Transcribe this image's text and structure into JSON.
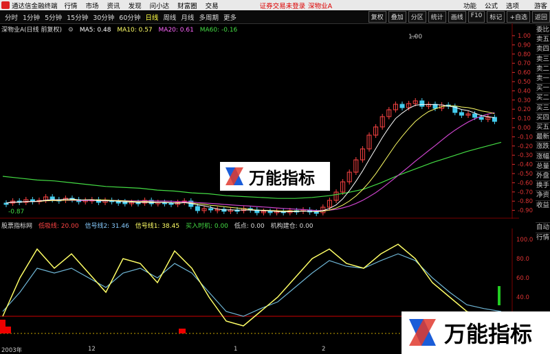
{
  "menubar": {
    "app_title": "通达信金融终端",
    "items": [
      "行情",
      "市场",
      "资讯",
      "发现",
      "问小达",
      "财富圈",
      "交易"
    ],
    "warning": "证券交易未登录",
    "stock_link": "深物业A",
    "right_items": [
      "功能",
      "公式",
      "选项",
      "游客"
    ]
  },
  "periodbar": {
    "periods": [
      "分时",
      "1分钟",
      "5分钟",
      "15分钟",
      "30分钟",
      "60分钟",
      "日线",
      "周线",
      "月线",
      "多周期",
      "更多"
    ],
    "active": "日线",
    "tools": [
      "复权",
      "叠加",
      "分区",
      "统计",
      "画线",
      "F10",
      "标记",
      "+自选",
      "返回"
    ]
  },
  "main_indicators": {
    "stock": "深物业A(日线 前复权)",
    "ma5": "MA5: 0.48",
    "ma10": "MA10: 0.57",
    "ma20": "MA20: 0.61",
    "ma60": "MA60: -0.16",
    "high_label": "1.00",
    "low_label": "-0.87",
    "colors": {
      "ma5": "#ffffff",
      "ma10": "#ffff66",
      "ma20": "#ff66ff",
      "ma60": "#44dd44"
    }
  },
  "price_axis": [
    "1.00",
    "0.90",
    "0.80",
    "0.70",
    "0.60",
    "0.50",
    "0.40",
    "0.30",
    "0.20",
    "0.10",
    "0.00",
    "-0.10",
    "-0.20",
    "-0.30",
    "-0.40",
    "-0.50",
    "-0.60",
    "-0.70",
    "-0.80",
    "-0.90"
  ],
  "side_tabs_top": [
    "委比",
    "卖五",
    "卖四",
    "卖三",
    "卖二",
    "卖一",
    "买一",
    "买二",
    "买三",
    "买四",
    "买五",
    "最新",
    "涨跌",
    "涨幅",
    "总量",
    "外盘",
    "换手",
    "净资",
    "收益"
  ],
  "side_tabs_bottom": [
    "自动",
    "行情"
  ],
  "sub_indicators": {
    "name": "股票指标网",
    "low_line": "低吸线: 20.00",
    "signal2": "信号线2: 31.46",
    "signal1": "信号线1: 38.45",
    "buy_time": "买入时机: 0.00",
    "low_point": "低点: 0.00",
    "inst_build": "机构建仓: 0.00",
    "axis": [
      "100.0",
      "80.0",
      "60.0",
      "40.0",
      "20.0"
    ]
  },
  "date_axis": [
    "2003年",
    "12",
    "1",
    "2"
  ],
  "watermark": "万能指标",
  "chart_data": {
    "type": "line",
    "series": [
      {
        "name": "MA60",
        "values": [
          -0.53,
          -0.55,
          -0.57,
          -0.58,
          -0.6,
          -0.62,
          -0.64,
          -0.65,
          -0.66,
          -0.68,
          -0.69,
          -0.71,
          -0.72,
          -0.74,
          -0.75,
          -0.76,
          -0.77,
          -0.77,
          -0.76,
          -0.74,
          -0.71,
          -0.67,
          -0.6,
          -0.52,
          -0.45,
          -0.38,
          -0.32,
          -0.26,
          -0.21,
          -0.16
        ]
      },
      {
        "name": "信号线1",
        "values": [
          20,
          60,
          90,
          70,
          85,
          65,
          45,
          80,
          75,
          55,
          88,
          70,
          40,
          15,
          10,
          25,
          40,
          60,
          80,
          90,
          75,
          70,
          85,
          95,
          80,
          55,
          40,
          25,
          20,
          15
        ]
      },
      {
        "name": "信号线2",
        "values": [
          25,
          45,
          70,
          65,
          70,
          60,
          50,
          65,
          70,
          60,
          75,
          65,
          45,
          25,
          20,
          28,
          35,
          50,
          65,
          78,
          72,
          70,
          78,
          85,
          78,
          60,
          45,
          32,
          28,
          25
        ]
      }
    ]
  }
}
